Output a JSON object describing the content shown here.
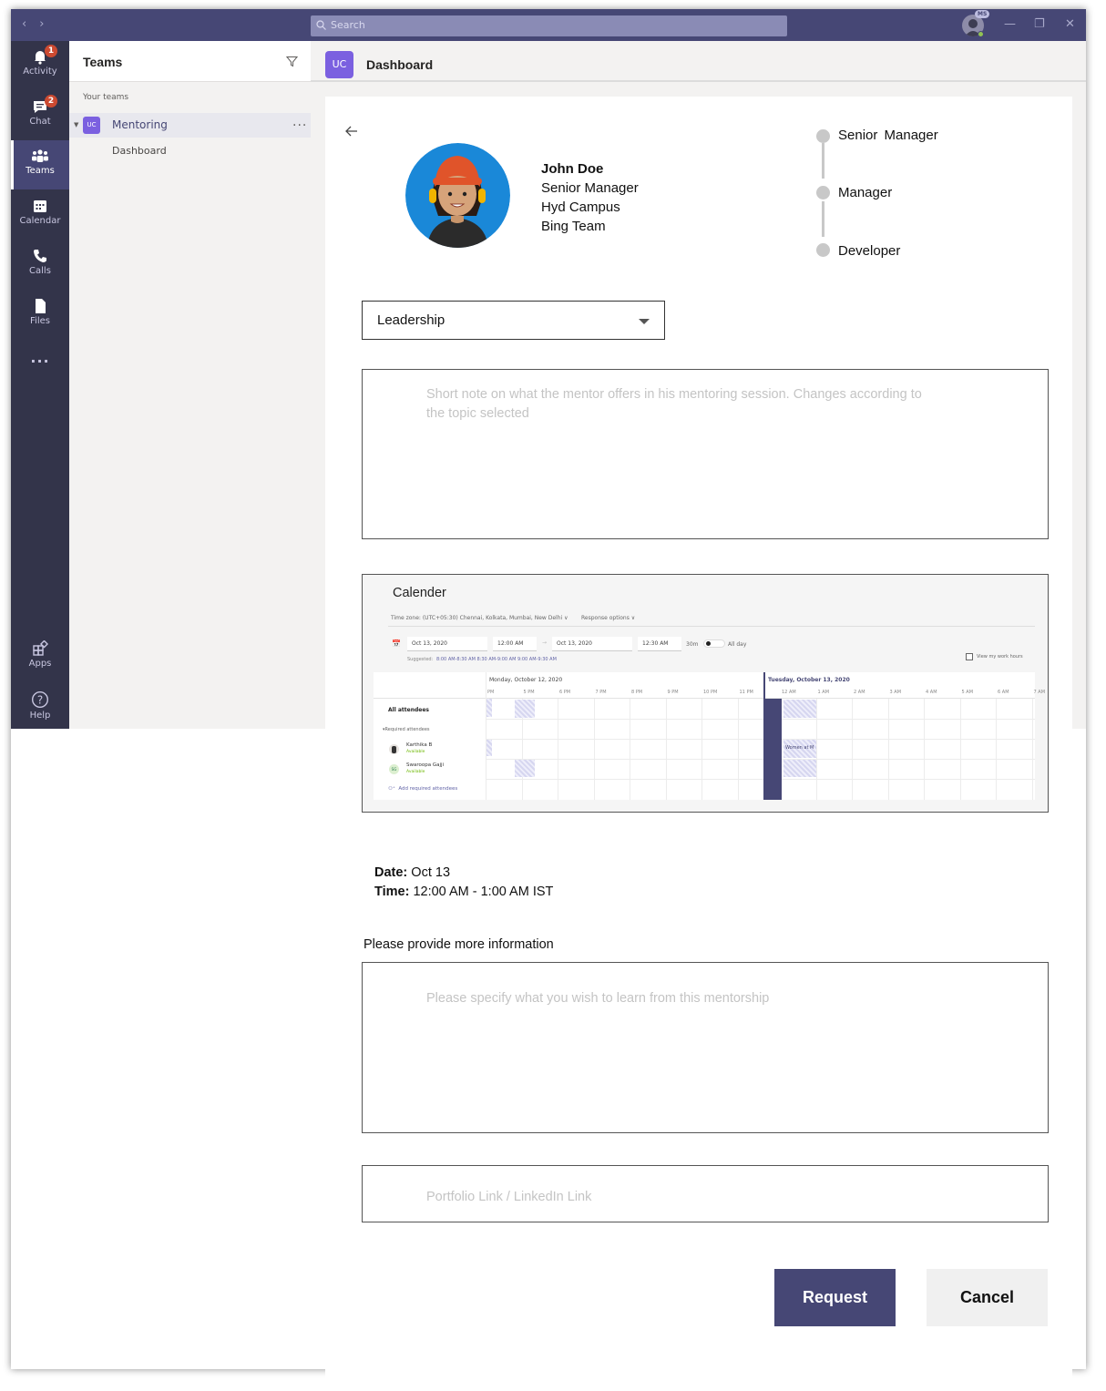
{
  "titlebar": {
    "search_placeholder": "Search",
    "account_badge": "MS",
    "nav_icons": [
      "back-icon",
      "forward-icon"
    ],
    "window_controls": [
      "minimize-icon",
      "maximize-icon",
      "close-icon"
    ]
  },
  "rail": {
    "items": [
      {
        "label": "Activity",
        "icon": "bell-icon",
        "badge": "1"
      },
      {
        "label": "Chat",
        "icon": "chat-icon",
        "badge": "2"
      },
      {
        "label": "Teams",
        "icon": "teams-icon",
        "active": true
      },
      {
        "label": "Calendar",
        "icon": "calendar-icon"
      },
      {
        "label": "Calls",
        "icon": "phone-icon"
      },
      {
        "label": "Files",
        "icon": "file-icon"
      },
      {
        "label": "...",
        "icon": "more-icon"
      }
    ],
    "bottom": [
      {
        "label": "Apps",
        "icon": "apps-icon"
      },
      {
        "label": "Help",
        "icon": "help-icon"
      }
    ]
  },
  "teams_panel": {
    "title": "Teams",
    "section": "Your teams",
    "team": {
      "tile": "UC",
      "name": "Mentoring",
      "more": "..."
    },
    "channel": "Dashboard"
  },
  "main": {
    "tile": "UC",
    "title": "Dashboard"
  },
  "profile": {
    "name": "John Doe",
    "role": "Senior Manager",
    "campus": "Hyd Campus",
    "team": "Bing Team"
  },
  "career_path": [
    "Senior  Manager",
    "Manager",
    "Developer"
  ],
  "topic_select": {
    "value": "Leadership"
  },
  "note_placeholder": "Short note on what the mentor offers in his mentoring session. Changes according to the topic selected",
  "calendar": {
    "title": "Calender",
    "timezone": "Time zone: (UTC+05:30) Chennai, Kolkata, Mumbai, New Delhi",
    "response_options": "Response options",
    "start_date": "Oct 13, 2020",
    "start_time": "12:00 AM",
    "end_date": "Oct 13, 2020",
    "end_time": "12:30 AM",
    "duration": "30m",
    "all_day": "All day",
    "suggested_label": "Suggested:",
    "suggested": "8:00 AM-8:30 AM  8:30 AM-9:00 AM  9:00 AM-9:30 AM",
    "work_hours": "View my work hours",
    "day1": "Monday, October 12, 2020",
    "day2": "Tuesday, October 13, 2020",
    "hours1": [
      "PM",
      "5 PM",
      "6 PM",
      "7 PM",
      "8 PM",
      "9 PM",
      "10 PM",
      "11 PM"
    ],
    "hours2": [
      "12 AM",
      "1 AM",
      "2 AM",
      "3 AM",
      "4 AM",
      "5 AM",
      "6 AM",
      "7 AM"
    ],
    "all_attendees": "All attendees",
    "required": "Required attendees",
    "attendees": [
      {
        "name": "Karthika B",
        "status": "Available"
      },
      {
        "name": "Swaroopa Gajji",
        "initials": "SG",
        "status": "Available"
      }
    ],
    "add_attendees": "Add required attendees",
    "event": "Women at M"
  },
  "selected": {
    "date_label": "Date:",
    "date": "Oct 13",
    "time_label": "Time:",
    "time": "12:00 AM - 1:00 AM IST"
  },
  "more_info_label": "Please provide more information",
  "learn_placeholder": "Please specify what you wish to learn from this mentorship",
  "link_placeholder": "Portfolio Link / LinkedIn Link",
  "actions": {
    "request": "Request",
    "cancel": "Cancel"
  },
  "colors": {
    "brand": "#464775",
    "rail": "#33344a",
    "tile": "#7b60e0",
    "badge": "#cc4a31"
  }
}
